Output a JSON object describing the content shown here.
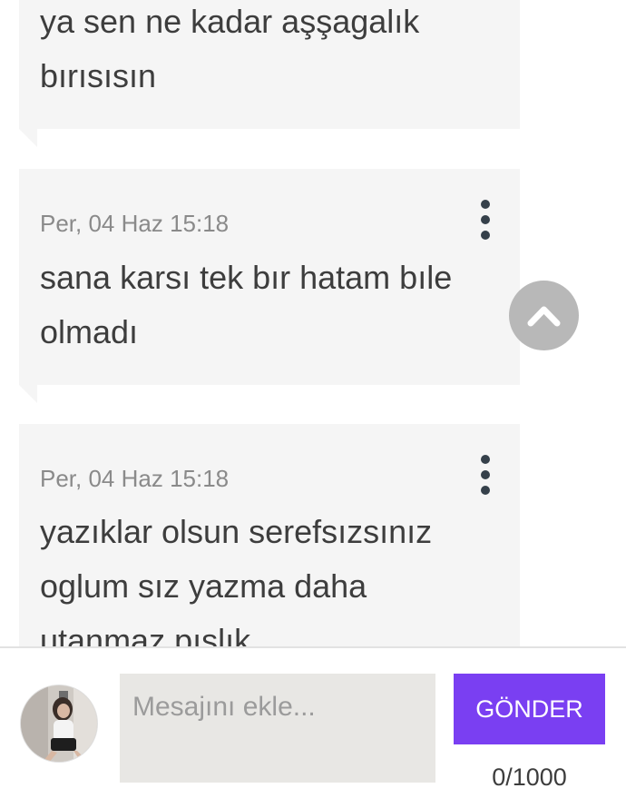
{
  "messages": [
    {
      "timestamp": "",
      "lines": [
        "ya sen ne kadar aşşagalık",
        "bırısısın"
      ]
    },
    {
      "timestamp": "Per, 04 Haz 15:18",
      "lines": [
        "sana karsı tek bır hatam bıle",
        "olmadı"
      ]
    },
    {
      "timestamp": "Per, 04 Haz 15:18",
      "lines": [
        "yazıklar olsun serefsızsınız",
        "oglum sız yazma daha",
        "utanmaz pıslık"
      ]
    }
  ],
  "icons": {
    "more": "vertical-dots-icon",
    "scroll_top": "chevron-up-icon"
  },
  "composer": {
    "placeholder": "Mesajını ekle...",
    "value": "",
    "send_label": "GÖNDER",
    "char_count": "0/1000"
  },
  "colors": {
    "bubble": "#f5f5f5",
    "accent": "#7a3ff2",
    "input_bg": "#e8e7e4",
    "scroll_button": "#b8b8b8"
  }
}
